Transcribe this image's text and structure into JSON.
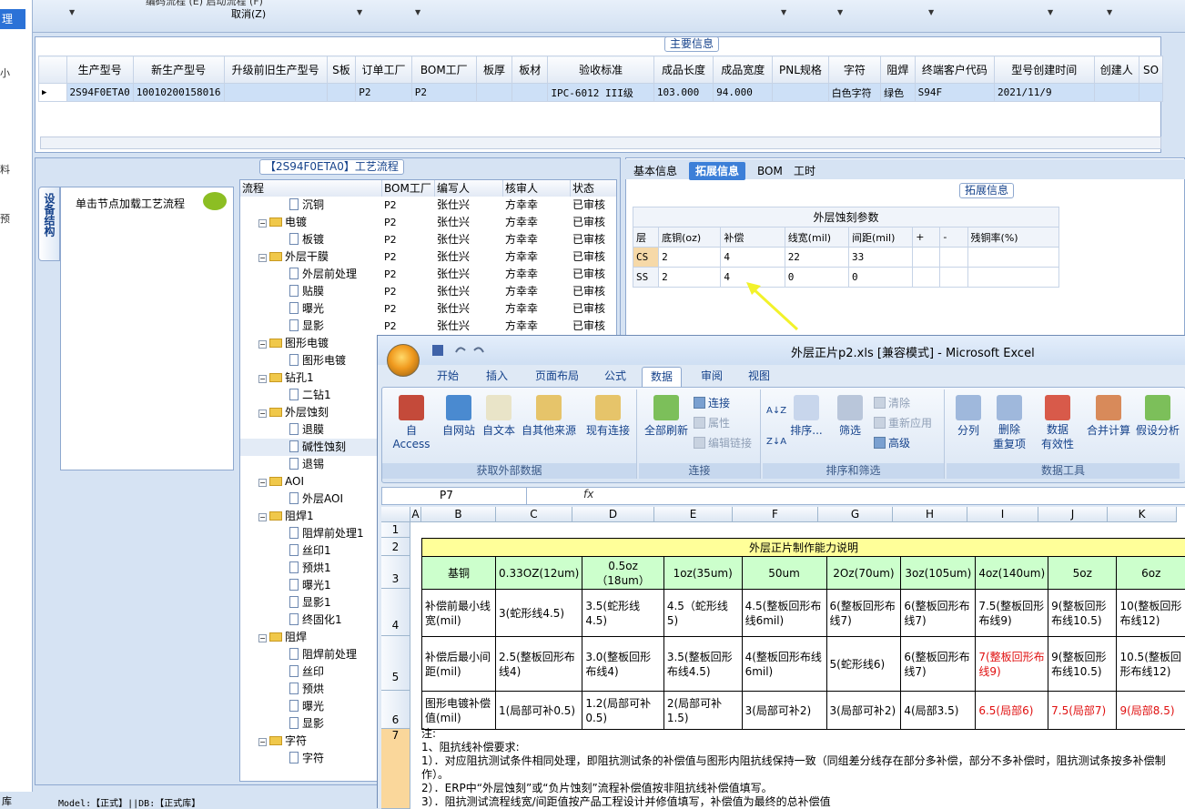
{
  "left_strip": {
    "selected": "理",
    "chars": [
      "小",
      "料",
      "预"
    ]
  },
  "toolbar": {
    "cancel_label": "取消(Z)",
    "menu_fragment": "编码流程 (E)    启动流程 (F)"
  },
  "main_info": {
    "title": "主要信息",
    "columns": [
      "生产型号",
      "新生产型号",
      "升级前旧生产型号",
      "S板",
      "订单工厂",
      "BOM工厂",
      "板厚",
      "板材",
      "验收标准",
      "成品长度",
      "成品宽度",
      "PNL规格",
      "字符",
      "阻焊",
      "终端客户代码",
      "型号创建时间",
      "创建人",
      "SO"
    ],
    "row": [
      "2S94F0ETA0",
      "10010200158016",
      "",
      "",
      "P2",
      "P2",
      "",
      "",
      "IPC-6012 III级",
      "103.000",
      "94.000",
      "",
      "白色字符",
      "绿色",
      "S94F",
      "2021/11/9",
      "",
      ""
    ]
  },
  "process": {
    "title": "【2S94F0ETA0】工艺流程",
    "side_tab": "设备结构",
    "hint": "单击节点加载工艺流程",
    "headers": [
      "流程",
      "BOM工厂",
      "编写人",
      "核审人",
      "状态"
    ],
    "rows": [
      {
        "name": "沉铜",
        "type": "leaf",
        "bom": "P2",
        "writer": "张仕兴",
        "reviewer": "方幸幸",
        "status": "已审核"
      },
      {
        "name": "电镀",
        "type": "folder",
        "bom": "P2",
        "writer": "张仕兴",
        "reviewer": "方幸幸",
        "status": "已审核"
      },
      {
        "name": "板镀",
        "type": "leaf",
        "bom": "P2",
        "writer": "张仕兴",
        "reviewer": "方幸幸",
        "status": "已审核"
      },
      {
        "name": "外层干膜",
        "type": "folder",
        "bom": "P2",
        "writer": "张仕兴",
        "reviewer": "方幸幸",
        "status": "已审核"
      },
      {
        "name": "外层前处理",
        "type": "leaf",
        "bom": "P2",
        "writer": "张仕兴",
        "reviewer": "方幸幸",
        "status": "已审核"
      },
      {
        "name": "贴膜",
        "type": "leaf",
        "bom": "P2",
        "writer": "张仕兴",
        "reviewer": "方幸幸",
        "status": "已审核"
      },
      {
        "name": "曝光",
        "type": "leaf",
        "bom": "P2",
        "writer": "张仕兴",
        "reviewer": "方幸幸",
        "status": "已审核"
      },
      {
        "name": "显影",
        "type": "leaf",
        "bom": "P2",
        "writer": "张仕兴",
        "reviewer": "方幸幸",
        "status": "已审核"
      },
      {
        "name": "图形电镀",
        "type": "folder",
        "bom": "",
        "writer": "",
        "reviewer": "",
        "status": ""
      },
      {
        "name": "图形电镀",
        "type": "leaf",
        "bom": "",
        "writer": "",
        "reviewer": "",
        "status": ""
      },
      {
        "name": "钻孔1",
        "type": "folder",
        "bom": "",
        "writer": "",
        "reviewer": "",
        "status": ""
      },
      {
        "name": "二钻1",
        "type": "leaf",
        "bom": "",
        "writer": "",
        "reviewer": "",
        "status": ""
      },
      {
        "name": "外层蚀刻",
        "type": "folder",
        "bom": "",
        "writer": "",
        "reviewer": "",
        "status": ""
      },
      {
        "name": "退膜",
        "type": "leaf",
        "bom": "",
        "writer": "",
        "reviewer": "",
        "status": ""
      },
      {
        "name": "碱性蚀刻",
        "type": "leaf",
        "bom": "",
        "writer": "",
        "reviewer": "",
        "status": ""
      },
      {
        "name": "退锡",
        "type": "leaf",
        "bom": "",
        "writer": "",
        "reviewer": "",
        "status": ""
      },
      {
        "name": "AOI",
        "type": "folder",
        "bom": "",
        "writer": "",
        "reviewer": "",
        "status": ""
      },
      {
        "name": "外层AOI",
        "type": "leaf",
        "bom": "",
        "writer": "",
        "reviewer": "",
        "status": ""
      },
      {
        "name": "阻焊1",
        "type": "folder",
        "bom": "",
        "writer": "",
        "reviewer": "",
        "status": ""
      },
      {
        "name": "阻焊前处理1",
        "type": "leaf",
        "bom": "",
        "writer": "",
        "reviewer": "",
        "status": ""
      },
      {
        "name": "丝印1",
        "type": "leaf",
        "bom": "",
        "writer": "",
        "reviewer": "",
        "status": ""
      },
      {
        "name": "预烘1",
        "type": "leaf",
        "bom": "",
        "writer": "",
        "reviewer": "",
        "status": ""
      },
      {
        "name": "曝光1",
        "type": "leaf",
        "bom": "",
        "writer": "",
        "reviewer": "",
        "status": ""
      },
      {
        "name": "显影1",
        "type": "leaf",
        "bom": "",
        "writer": "",
        "reviewer": "",
        "status": ""
      },
      {
        "name": "终固化1",
        "type": "leaf",
        "bom": "",
        "writer": "",
        "reviewer": "",
        "status": ""
      },
      {
        "name": "阻焊",
        "type": "folder",
        "bom": "",
        "writer": "",
        "reviewer": "",
        "status": ""
      },
      {
        "name": "阻焊前处理",
        "type": "leaf",
        "bom": "",
        "writer": "",
        "reviewer": "",
        "status": ""
      },
      {
        "name": "丝印",
        "type": "leaf",
        "bom": "",
        "writer": "",
        "reviewer": "",
        "status": ""
      },
      {
        "name": "预烘",
        "type": "leaf",
        "bom": "",
        "writer": "",
        "reviewer": "",
        "status": ""
      },
      {
        "name": "曝光",
        "type": "leaf",
        "bom": "",
        "writer": "",
        "reviewer": "",
        "status": ""
      },
      {
        "name": "显影",
        "type": "leaf",
        "bom": "",
        "writer": "",
        "reviewer": "",
        "status": ""
      },
      {
        "name": "字符",
        "type": "folder",
        "bom": "",
        "writer": "",
        "reviewer": "",
        "status": ""
      },
      {
        "name": "字符",
        "type": "leaf",
        "bom": "",
        "writer": "",
        "reviewer": "",
        "status": ""
      }
    ]
  },
  "right": {
    "tabs": [
      "基本信息",
      "拓展信息",
      "BOM",
      "工时"
    ],
    "active_tab": 1,
    "section_title": "拓展信息",
    "grid_caption": "外层蚀刻参数",
    "headers": [
      "层",
      "底铜(oz)",
      "补偿",
      "线宽(mil)",
      "间距(mil)",
      "+",
      "-",
      "残铜率(%)"
    ],
    "rows": [
      [
        "CS",
        "2",
        "4",
        "22",
        "33",
        "",
        "",
        ""
      ],
      [
        "SS",
        "2",
        "4",
        "0",
        "0",
        "",
        "",
        ""
      ]
    ]
  },
  "excel": {
    "title": "外层正片p2.xls  [兼容模式] - Microsoft Excel",
    "tabs": [
      "开始",
      "插入",
      "页面布局",
      "公式",
      "数据",
      "审阅",
      "视图"
    ],
    "active_tab": 4,
    "groups": [
      {
        "label": "获取外部数据",
        "buttons": [
          "自 Access",
          "自网站",
          "自文本",
          "自其他来源",
          "现有连接"
        ]
      },
      {
        "label": "连接",
        "buttons": [
          "全部刷新",
          "连接",
          "属性",
          "编辑链接"
        ]
      },
      {
        "label": "排序和筛选",
        "buttons": [
          "排序...",
          "筛选",
          "清除",
          "重新应用",
          "高级"
        ]
      },
      {
        "label": "数据工具",
        "buttons": [
          "分列",
          "删除\n重复项",
          "数据\n有效性",
          "合并计算",
          "假设分析"
        ]
      }
    ],
    "name_box": "P7",
    "fx": "fx",
    "columns": [
      "A",
      "B",
      "C",
      "D",
      "E",
      "F",
      "G",
      "H",
      "I",
      "J",
      "K"
    ],
    "row_numbers": [
      "1",
      "2",
      "3",
      "4",
      "5",
      "6",
      "7"
    ],
    "sheet_title": "外层正片制作能力说明",
    "header_row": [
      "基铜",
      "0.33OZ(12um)",
      "0.5oz（18um）",
      "1oz(35um)",
      "50um",
      "2Oz(70um)",
      "3oz(105um)",
      "4oz(140um)",
      "5oz",
      "6oz"
    ],
    "rows": [
      [
        "补偿前最小线宽(mil)",
        "3(蛇形线4.5)",
        "3.5(蛇形线4.5)",
        "4.5（蛇形线5)",
        "4.5(整板回形布线6mil)",
        "6(整板回形布线7)",
        "6(整板回形布线7)",
        "7.5(整板回形布线9)",
        "9(整板回形布线10.5)",
        "10(整板回形布线12)"
      ],
      [
        "补偿后最小间距(mil)",
        "2.5(整板回形布线4)",
        "3.0(整板回形布线4)",
        "3.5(整板回形布线4.5)",
        "4(整板回形布线6mil)",
        "5(蛇形线6)",
        "6(整板回形布线7)",
        "7(整板回形布线9)",
        "9(整板回形布线10.5)",
        "10.5(整板回形布线12)"
      ],
      [
        "图形电镀补偿值(mil)",
        "1(局部可补0.5)",
        "1.2(局部可补0.5)",
        "2(局部可补1.5)",
        "3(局部可补2)",
        "3(局部可补2)",
        "4(局部3.5)",
        "6.5(局部6)",
        "7.5(局部7)",
        "9(局部8.5)"
      ]
    ],
    "notes": [
      "注:",
      "1、阻抗线补偿要求:",
      "1）．对应阻抗测试条件相同处理，即阻抗测试条的补偿值与图形内阻抗线保持一致（同组差分线存在部分多补偿，部分不多补偿时，阻抗测试条按多补偿制作）。",
      "2）．ERP中“外层蚀刻”或“负片蚀刻”流程补偿值按非阻抗线补偿值填写。",
      "3）．阻抗测试流程线宽/间距值按产品工程设计并修值填写，补偿值为最终的总补偿值"
    ]
  },
  "statusbar": {
    "left": "库",
    "model": "Model:【正式】||DB:【正式库】"
  },
  "colors": {
    "accent": "#3c7fd8",
    "selection": "#cde0f7",
    "folder": "#f0c84a",
    "arrow": "#f2f22a",
    "red_text": "#e01010"
  }
}
